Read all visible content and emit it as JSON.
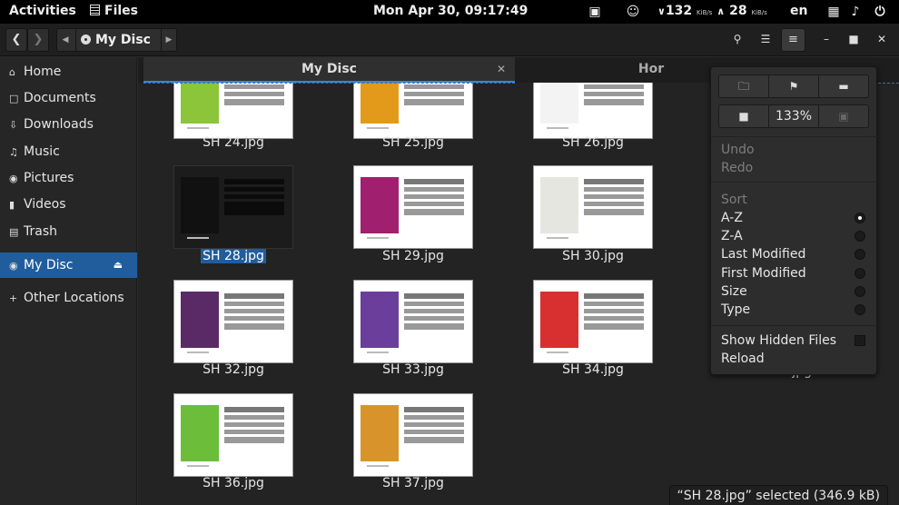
{
  "topbar": {
    "activities": "Activities",
    "app_name": "Files",
    "clock": "Mon Apr 30, 09:17:49",
    "net_down": "132",
    "net_down_unit": "KiB/s",
    "net_up": "28",
    "net_up_unit": "KiB/s",
    "language": "en"
  },
  "header": {
    "location": "My Disc"
  },
  "sidebar": {
    "items": [
      {
        "label": "Home",
        "icon": "home-icon"
      },
      {
        "label": "Documents",
        "icon": "document-icon"
      },
      {
        "label": "Downloads",
        "icon": "download-icon"
      },
      {
        "label": "Music",
        "icon": "music-icon"
      },
      {
        "label": "Pictures",
        "icon": "camera-icon"
      },
      {
        "label": "Videos",
        "icon": "video-icon"
      },
      {
        "label": "Trash",
        "icon": "trash-icon"
      }
    ],
    "device": {
      "label": "My Disc",
      "icon": "disc-icon",
      "active": true
    },
    "other": {
      "label": "Other Locations",
      "icon": "plus-icon"
    }
  },
  "tabs": [
    {
      "label": "My Disc",
      "active": true
    },
    {
      "label": "Hor",
      "active": false
    }
  ],
  "files": [
    {
      "name": "SH 24.jpg",
      "image_color": "#8cc43a"
    },
    {
      "name": "SH 25.jpg",
      "image_color": "#e39a1a"
    },
    {
      "name": "SH 26.jpg",
      "image_color": "#f3f3f3"
    },
    {
      "name": "SH 28.jpg",
      "image_color": "#111111",
      "selected": true
    },
    {
      "name": "SH 29.jpg",
      "image_color": "#a01f6e"
    },
    {
      "name": "SH 30.jpg",
      "image_color": "#e6e6e0"
    },
    {
      "name": "SH 32.jpg",
      "image_color": "#5a2a66"
    },
    {
      "name": "SH 33.jpg",
      "image_color": "#6a3e9a"
    },
    {
      "name": "SH 34.jpg",
      "image_color": "#d83030"
    },
    {
      "name": "SH 36.jpg",
      "image_color": "#6bbd3a"
    },
    {
      "name": "SH 37.jpg",
      "image_color": "#d8942a"
    }
  ],
  "partial_file_label": ".jpg",
  "menu": {
    "zoom": "133%",
    "undo": "Undo",
    "redo": "Redo",
    "sort_heading": "Sort",
    "sort_options": [
      {
        "label": "A-Z",
        "checked": true
      },
      {
        "label": "Z-A",
        "checked": false
      },
      {
        "label": "Last Modified",
        "checked": false
      },
      {
        "label": "First Modified",
        "checked": false
      },
      {
        "label": "Size",
        "checked": false
      },
      {
        "label": "Type",
        "checked": false
      }
    ],
    "show_hidden": "Show Hidden Files",
    "reload": "Reload"
  },
  "status": "“SH 28.jpg” selected (346.9 kB)",
  "colors": {
    "accent": "#215d9c",
    "tab_underline": "#3584e4"
  }
}
